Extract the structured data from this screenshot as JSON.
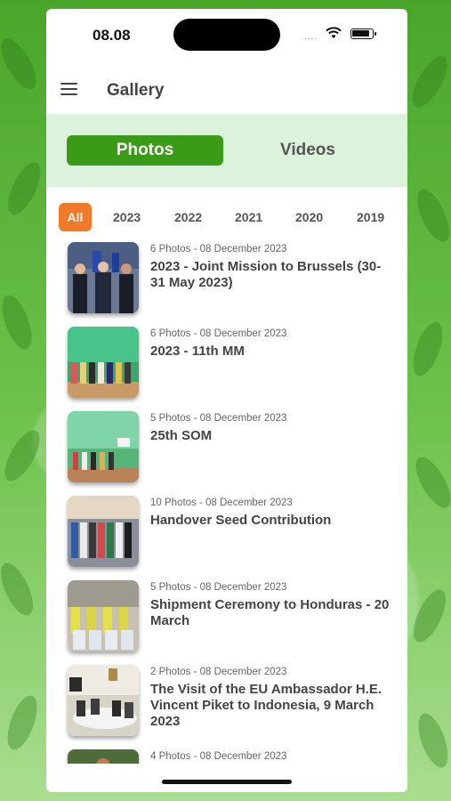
{
  "status_bar": {
    "time": "08.08",
    "signal": "....",
    "wifi_icon": "wifi-icon",
    "battery_icon": "battery-icon"
  },
  "header": {
    "menu_icon": "hamburger-menu-icon",
    "title": "Gallery"
  },
  "tabs": [
    {
      "label": "Photos",
      "active": true
    },
    {
      "label": "Videos",
      "active": false
    }
  ],
  "years": [
    "All",
    "2023",
    "2022",
    "2021",
    "2020",
    "2019"
  ],
  "selected_year": "All",
  "colors": {
    "accent_green": "#3a9c16",
    "tab_bg": "#ddf2dc",
    "year_active": "#f07a2a"
  },
  "albums": [
    {
      "meta": "6 Photos - 08 December 2023",
      "title": "2023 - Joint Mission to Brussels (30-31 May 2023)"
    },
    {
      "meta": "6 Photos - 08 December 2023",
      "title": "2023 - 11th MM"
    },
    {
      "meta": "5 Photos - 08 December 2023",
      "title": "25th SOM"
    },
    {
      "meta": "10 Photos - 08 December 2023",
      "title": "Handover Seed Contribution"
    },
    {
      "meta": "5 Photos - 08 December 2023",
      "title": "Shipment Ceremony to Honduras - 20 March"
    },
    {
      "meta": "2 Photos - 08 December 2023",
      "title": "The Visit of the EU Ambassador H.E. Vincent Piket to Indonesia, 9 March 2023"
    },
    {
      "meta": "4 Photos - 08 December 2023",
      "title": ""
    }
  ]
}
